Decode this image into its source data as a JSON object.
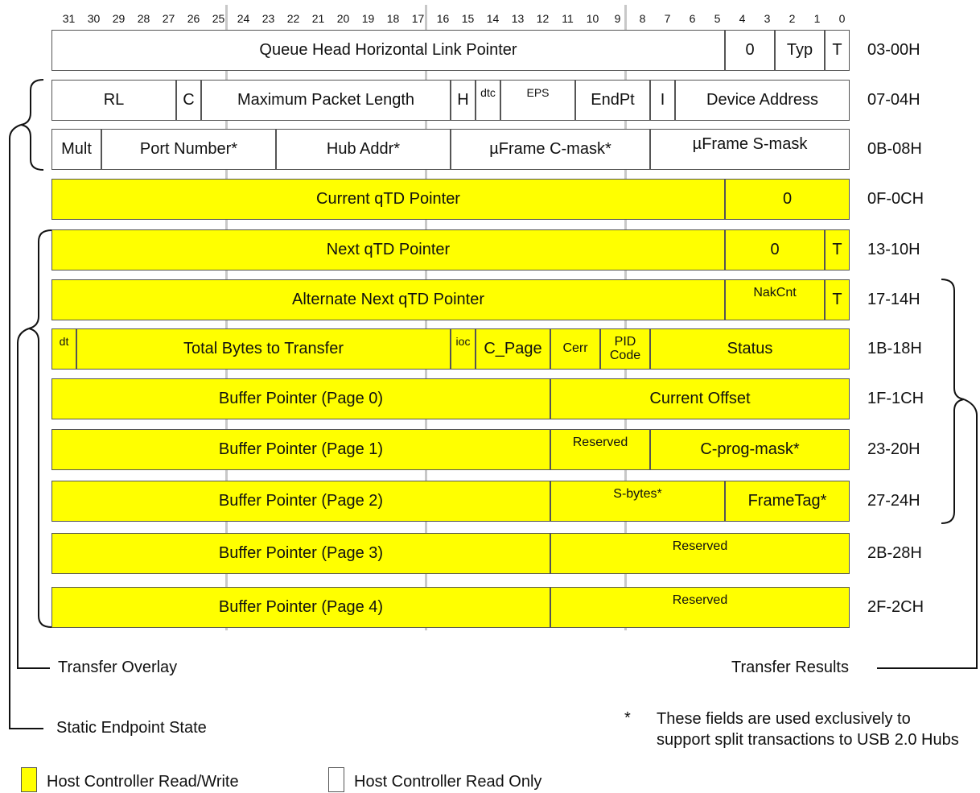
{
  "bit_numbers": [
    "31",
    "30",
    "29",
    "28",
    "27",
    "26",
    "25",
    "24",
    "23",
    "22",
    "21",
    "20",
    "19",
    "18",
    "17",
    "16",
    "15",
    "14",
    "13",
    "12",
    "11",
    "10",
    "9",
    "8",
    "7",
    "6",
    "5",
    "4",
    "3",
    "2",
    "1",
    "0"
  ],
  "rows": [
    {
      "offset": "03-00H",
      "cells": [
        {
          "label": "Queue Head Horizontal Link Pointer",
          "rw": false
        },
        {
          "label": "0",
          "rw": false
        },
        {
          "label": "Typ",
          "rw": false
        },
        {
          "label": "T",
          "rw": false
        }
      ]
    },
    {
      "offset": "07-04H",
      "cells": [
        {
          "label": "RL",
          "rw": false
        },
        {
          "label": "C",
          "rw": false
        },
        {
          "label": "Maximum Packet Length",
          "rw": false
        },
        {
          "label": "H",
          "rw": false
        },
        {
          "label": "dtc",
          "rw": false
        },
        {
          "label": "EPS",
          "rw": false
        },
        {
          "label": "EndPt",
          "rw": false
        },
        {
          "label": "I",
          "rw": false
        },
        {
          "label": "Device Address",
          "rw": false
        }
      ]
    },
    {
      "offset": "0B-08H",
      "cells": [
        {
          "label": "Mult",
          "rw": false
        },
        {
          "label": "Port Number*",
          "rw": false
        },
        {
          "label": "Hub Addr*",
          "rw": false
        },
        {
          "label": "µFrame C-mask*",
          "rw": false
        },
        {
          "label": "µFrame S-mask",
          "rw": false
        }
      ]
    },
    {
      "offset": "0F-0CH",
      "cells": [
        {
          "label": "Current qTD Pointer",
          "rw": true
        },
        {
          "label": "0",
          "rw": true
        }
      ]
    },
    {
      "offset": "13-10H",
      "cells": [
        {
          "label": "Next qTD Pointer",
          "rw": true
        },
        {
          "label": "0",
          "rw": true
        },
        {
          "label": "T",
          "rw": true
        }
      ]
    },
    {
      "offset": "17-14H",
      "cells": [
        {
          "label": "Alternate Next qTD Pointer",
          "rw": true
        },
        {
          "label": "NakCnt",
          "rw": true
        },
        {
          "label": "T",
          "rw": true
        }
      ]
    },
    {
      "offset": "1B-18H",
      "cells": [
        {
          "label": "dt",
          "rw": true
        },
        {
          "label": "Total Bytes to Transfer",
          "rw": true
        },
        {
          "label": "ioc",
          "rw": true
        },
        {
          "label": "C_Page",
          "rw": true
        },
        {
          "label": "Cerr",
          "rw": true
        },
        {
          "label": "PID Code",
          "rw": true
        },
        {
          "label": "Status",
          "rw": true
        }
      ]
    },
    {
      "offset": "1F-1CH",
      "cells": [
        {
          "label": "Buffer Pointer (Page 0)",
          "rw": true
        },
        {
          "label": "Current Offset",
          "rw": true
        }
      ]
    },
    {
      "offset": "23-20H",
      "cells": [
        {
          "label": "Buffer Pointer (Page 1)",
          "rw": true
        },
        {
          "label": "Reserved",
          "rw": true
        },
        {
          "label": "C-prog-mask*",
          "rw": true
        }
      ]
    },
    {
      "offset": "27-24H",
      "cells": [
        {
          "label": "Buffer Pointer (Page 2)",
          "rw": true
        },
        {
          "label": "S-bytes*",
          "rw": true
        },
        {
          "label": "FrameTag*",
          "rw": true
        }
      ]
    },
    {
      "offset": "2B-28H",
      "cells": [
        {
          "label": "Buffer Pointer (Page 3)",
          "rw": true
        },
        {
          "label": "Reserved",
          "rw": true
        }
      ]
    },
    {
      "offset": "2F-2CH",
      "cells": [
        {
          "label": "Buffer Pointer (Page 4)",
          "rw": true
        },
        {
          "label": "Reserved",
          "rw": true
        }
      ]
    }
  ],
  "annotations": {
    "transfer_overlay": "Transfer Overlay",
    "transfer_results": "Transfer Results",
    "static_endpoint_state": "Static Endpoint State",
    "footnote_marker": "*",
    "footnote_text": "These fields are used exclusively to support split transactions to USB 2.0 Hubs"
  },
  "legend": {
    "read_write": "Host Controller Read/Write",
    "read_only": "Host Controller Read Only"
  },
  "colors": {
    "read_write_fill": "#ffff00",
    "read_only_fill": "#ffffff",
    "border": "#555555"
  }
}
